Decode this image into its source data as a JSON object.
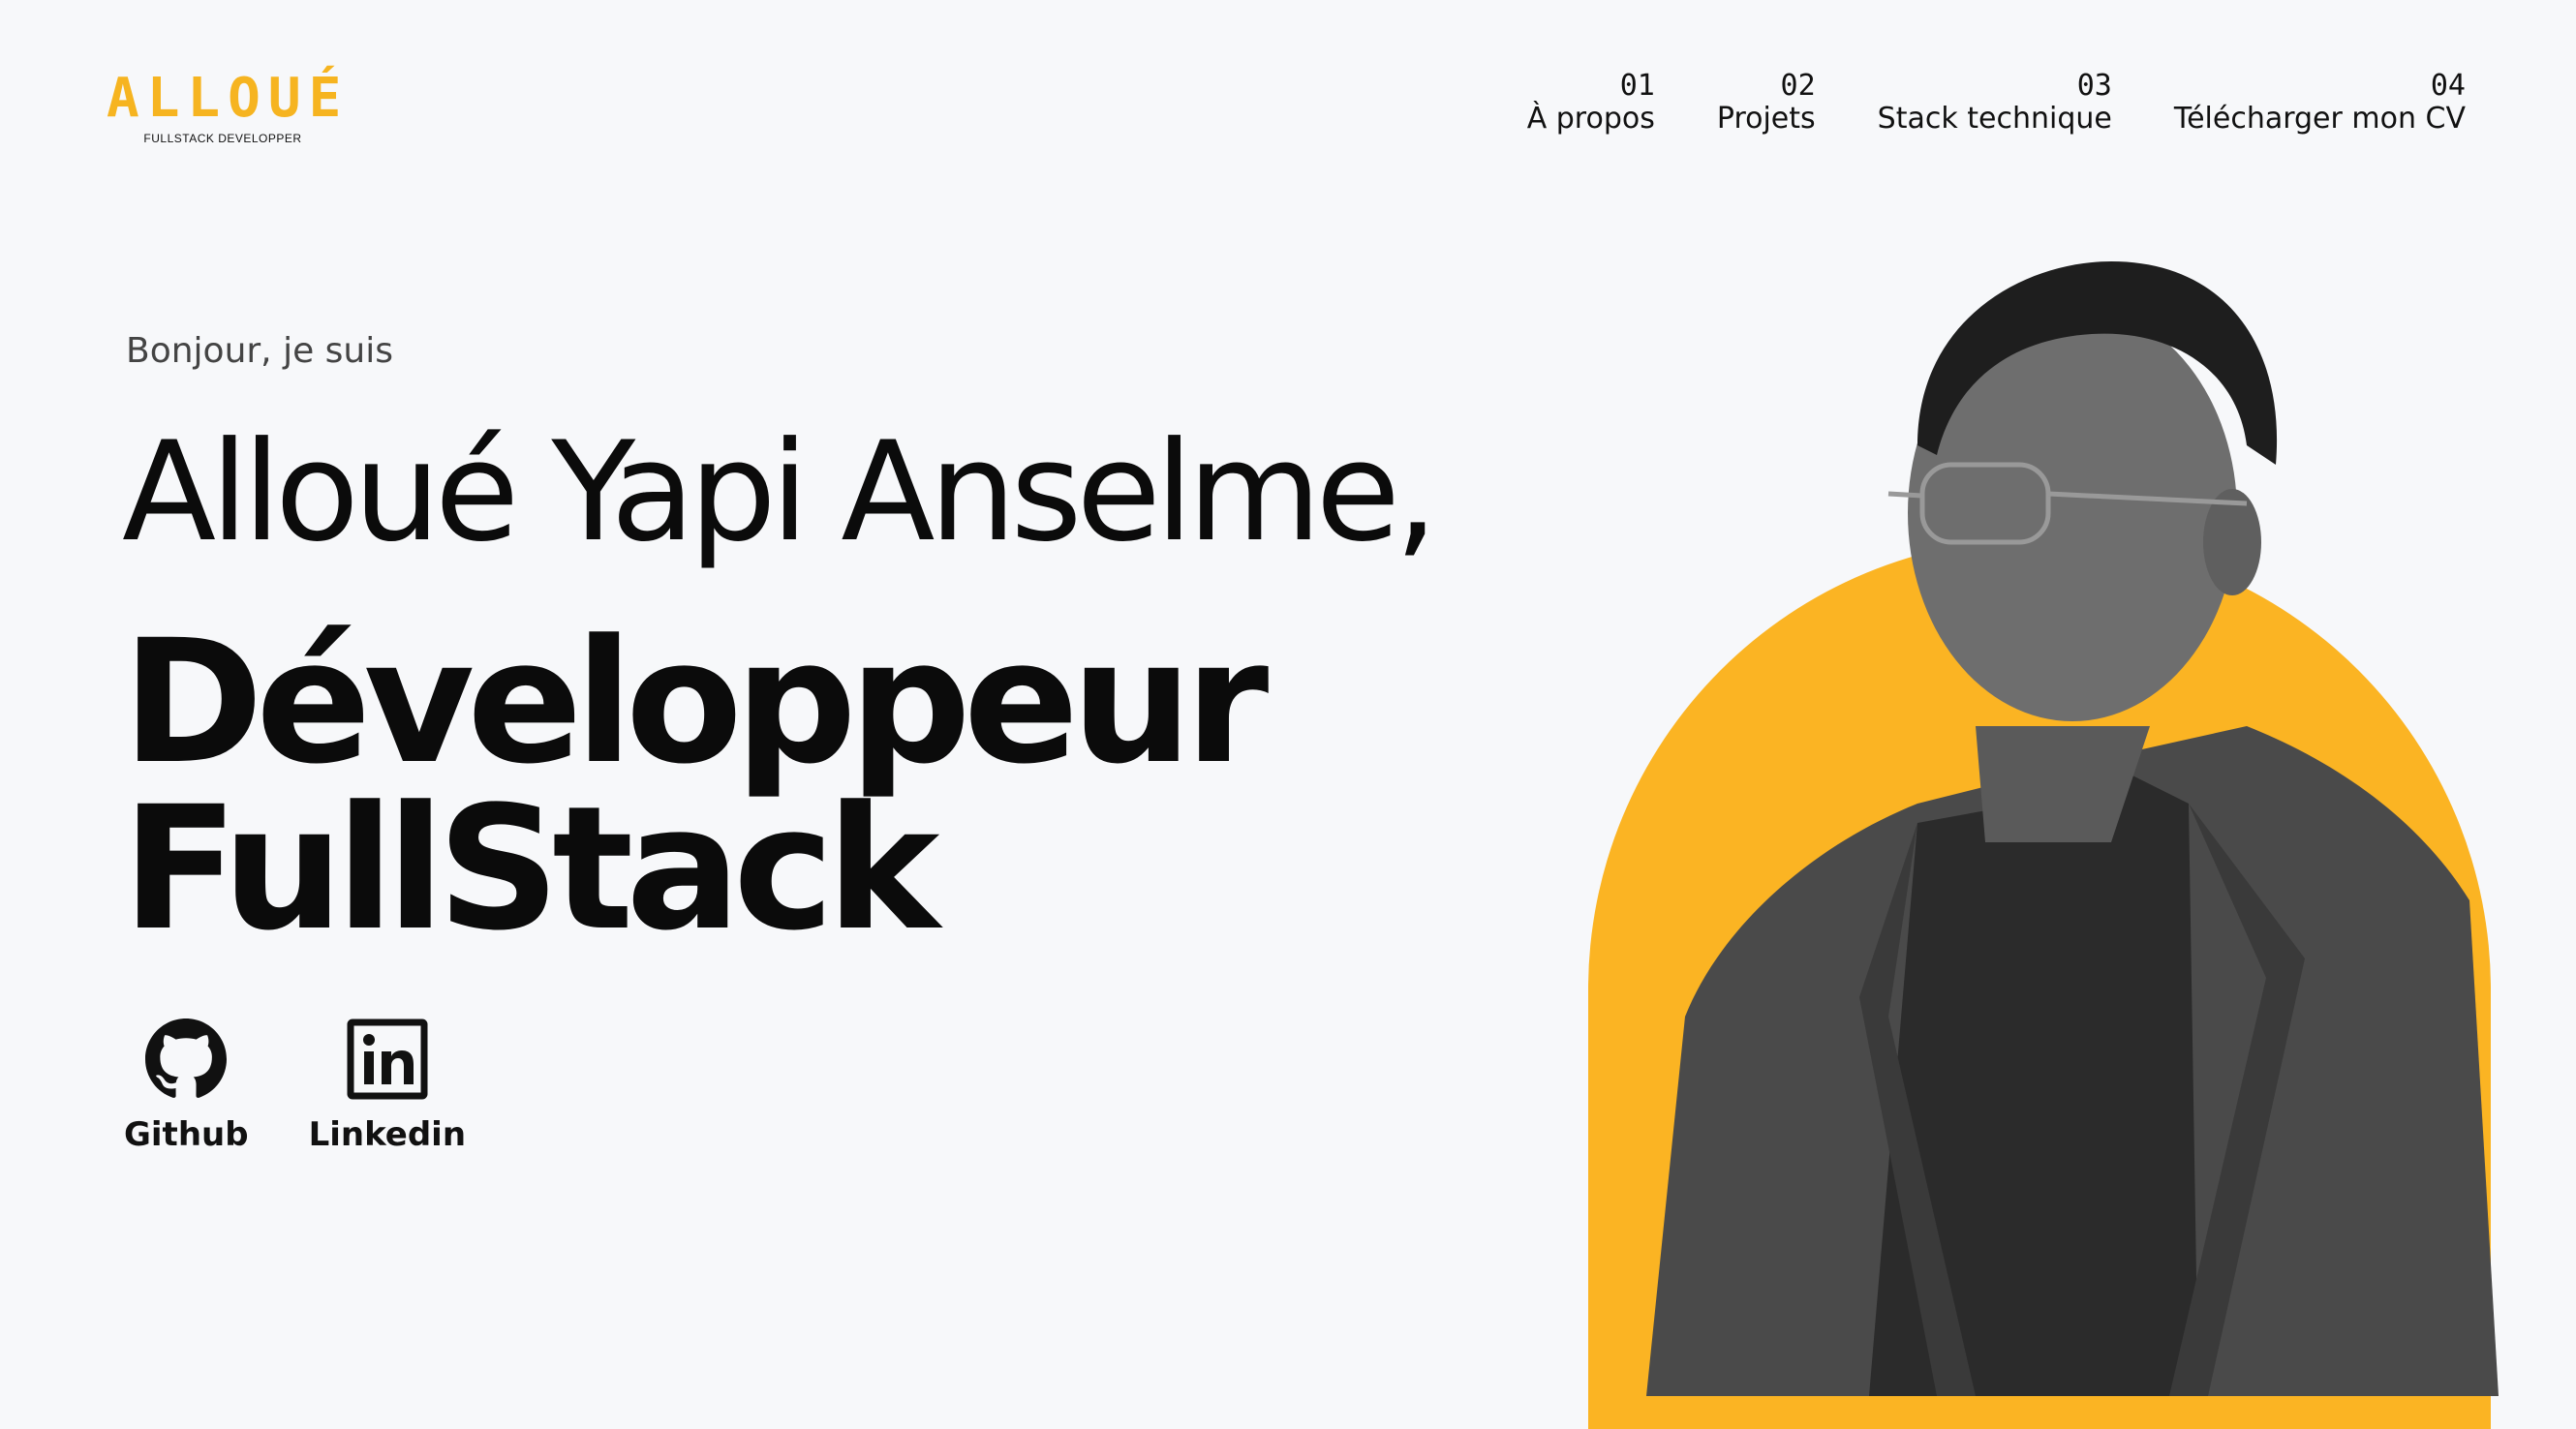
{
  "brand": {
    "logo_text": "ALLOUÉ",
    "tagline": "FULLSTACK DEVELOPPER",
    "accent_color": "#f6b420"
  },
  "nav": {
    "items": [
      {
        "number": "01",
        "label": "À propos"
      },
      {
        "number": "02",
        "label": "Projets"
      },
      {
        "number": "03",
        "label": "Stack technique"
      },
      {
        "number": "04",
        "label": "Télécharger mon CV"
      }
    ]
  },
  "hero": {
    "greeting": "Bonjour, je suis",
    "name": "Alloué Yapi Anselme,",
    "role_line1": "Développeur",
    "role_line2": "FullStack",
    "arch_color": "#fbb423"
  },
  "socials": [
    {
      "label": "Github",
      "icon": "github-icon"
    },
    {
      "label": "Linkedin",
      "icon": "linkedin-icon"
    }
  ]
}
